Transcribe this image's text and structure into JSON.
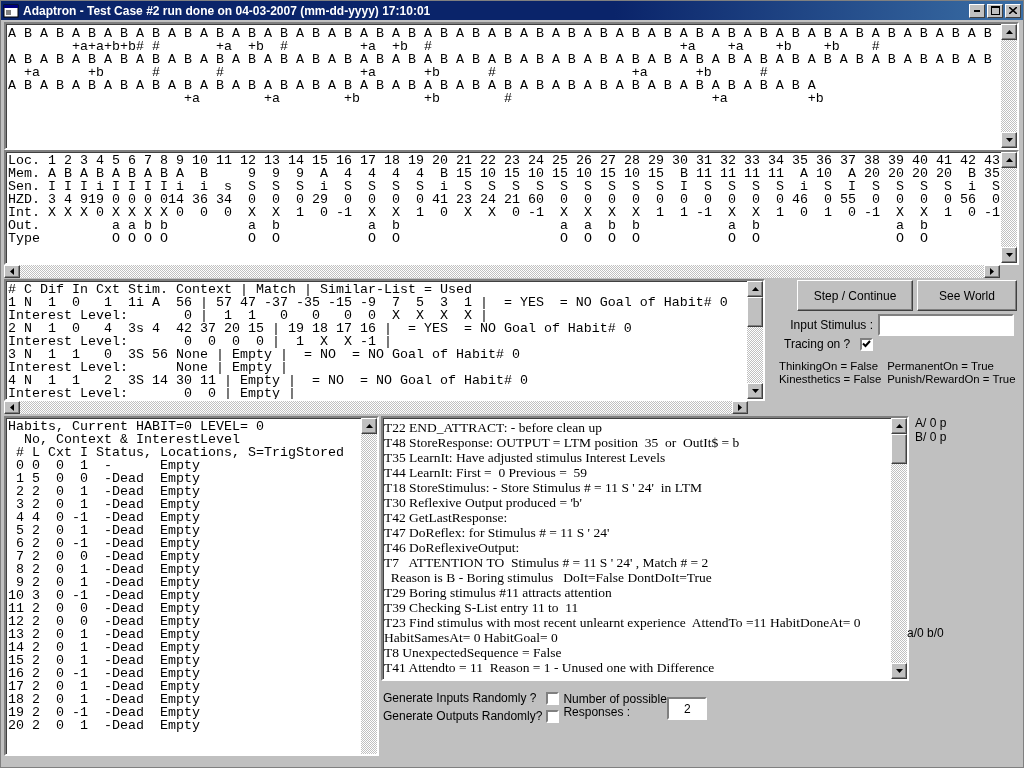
{
  "window": {
    "title": "Adaptron - Test Case #2 run done on 04-03-2007 (mm-dd-yyyy) 17:10:01"
  },
  "sequence_view": {
    "lines": [
      "A B A B A B A B A B A B A B A B A B A B A B A B A B A B A B A B A B A B A B A B A B A B A B A B A B A B A B A B A B A B A B",
      "        +a+a+b+b# #       +a  +b  #         +a  +b  #                               +a    +a    +b    +b    #",
      "A B A B A B A B A B A B A B A B A B A B A B A B A B A B A B A B A B A B A B A B A B A B A B A B A B A B A B A B A B A B A B",
      "  +a      +b      #       #                 +a      +b      #                 +a      +b      #",
      "A B A B A B A B A B A B A B A B A B A B A B A B A B A B A B A B A B A B A B A B A B A B A B A B A B A",
      "                      +a        +a        +b        +b        #                         +a          +b"
    ]
  },
  "memory_table": {
    "columns": [
      "Loc.",
      "1",
      "2",
      "3",
      "4",
      "5",
      "6",
      "7",
      "8",
      "9",
      "10",
      "11",
      "12",
      "13",
      "14",
      "15",
      "16",
      "17",
      "18",
      "19",
      "20",
      "21",
      "22",
      "23",
      "24",
      "25",
      "26",
      "27",
      "28",
      "29",
      "30",
      "31",
      "32",
      "33",
      "34",
      "35",
      "36",
      "37",
      "38",
      "39",
      "40",
      "41",
      "42",
      "43"
    ],
    "rows": [
      {
        "cells": [
          "Mem.",
          "A",
          "B",
          "A",
          "B",
          "A",
          "B",
          "A",
          "B",
          "A",
          "B",
          null,
          "9",
          "9",
          "9",
          "A",
          "4",
          "4",
          "4",
          "4",
          "B",
          "15",
          "10",
          "15",
          "10",
          "15",
          "10",
          "15",
          "10",
          "15",
          "B",
          "11",
          "11",
          "11",
          "11",
          "A",
          "10",
          "A",
          "20",
          "20",
          "20",
          "20",
          "B",
          "35"
        ]
      },
      {
        "cells": [
          "Sen.",
          "I",
          "I",
          "I",
          "i",
          "I",
          "I",
          "I",
          "I",
          "i",
          "i",
          "s",
          "S",
          "S",
          "S",
          "i",
          "S",
          "S",
          "S",
          "S",
          "i",
          "S",
          "S",
          "S",
          "S",
          "S",
          "S",
          "S",
          "S",
          "S",
          "I",
          "S",
          "S",
          "S",
          "S",
          "i",
          "S",
          "I",
          "S",
          "S",
          "S",
          "S",
          "i",
          "S"
        ]
      },
      {
        "cells": [
          "HZD.",
          "3",
          "4",
          "9",
          "19",
          "0",
          "0",
          "0",
          "0",
          "14",
          "36",
          "34",
          "0",
          "0",
          "0",
          "29",
          "0",
          "0",
          "0",
          "0",
          "41",
          "23",
          "24",
          "21",
          "60",
          "0",
          "0",
          "0",
          "0",
          "0",
          "0",
          "0",
          "0",
          "0",
          "0",
          "46",
          "0",
          "55",
          "0",
          "0",
          "0",
          "0",
          "56",
          "0"
        ]
      },
      {
        "cells": [
          "Int.",
          "X",
          "X",
          "X",
          "0",
          "X",
          "X",
          "X",
          "X",
          "0",
          "0",
          "0",
          "X",
          "X",
          "1",
          "0",
          "-1",
          "X",
          "X",
          "1",
          "0",
          "X",
          "X",
          "0",
          "-1",
          "X",
          "X",
          "X",
          "X",
          "1",
          "1",
          "-1",
          "X",
          "X",
          "1",
          "0",
          "1",
          "0",
          "-1",
          "X",
          "X",
          "1",
          "0",
          "-1"
        ]
      },
      {
        "cells": [
          "Out.",
          null,
          null,
          null,
          null,
          "a",
          "a",
          "b",
          "b",
          null,
          null,
          null,
          "a",
          "b",
          null,
          null,
          null,
          "a",
          "b",
          null,
          null,
          null,
          null,
          null,
          null,
          "a",
          "a",
          "b",
          "b",
          null,
          null,
          null,
          "a",
          "b",
          null,
          null,
          null,
          null,
          null,
          "a",
          "b",
          null,
          null,
          null
        ]
      },
      {
        "cells": [
          "Type",
          null,
          null,
          null,
          null,
          "O",
          "O",
          "O",
          "O",
          null,
          null,
          null,
          "O",
          "O",
          null,
          null,
          null,
          "O",
          "O",
          null,
          null,
          null,
          null,
          null,
          null,
          "O",
          "O",
          "O",
          "O",
          null,
          null,
          null,
          "O",
          "O",
          null,
          null,
          null,
          null,
          null,
          "O",
          "O",
          null,
          null,
          null
        ]
      }
    ]
  },
  "context_list": {
    "lines": [
      "# C Dif In Cxt Stim. Context | Match | Similar-List = Used",
      "1 N  1  0   1  1i A  56 | 57 47 -37 -35 -15 -9  7  5  3  1 |  = YES  = NO Goal of Habit# 0",
      "Interest Level:       0 |  1  1   0   0   0  0  X  X  X  X |",
      "2 N  1  0   4  3s 4  42 37 20 15 | 19 18 17 16 |  = YES  = NO Goal of Habit# 0",
      "Interest Level:       0  0  0  0 |  1  X  X -1 |",
      "3 N  1  1   0  3S 56 None | Empty |  = NO  = NO Goal of Habit# 0",
      "Interest Level:      None | Empty |",
      "4 N  1  1   2  3S 14 30 11 | Empty |  = NO  = NO Goal of Habit# 0",
      "Interest Level:       0  0 | Empty |"
    ]
  },
  "controls": {
    "step_button": "Step / Continue",
    "world_button": "See World",
    "input_stimulus": {
      "label": "Input Stimulus :"
    },
    "tracing": {
      "label": "Tracing on ?",
      "checked": true
    },
    "status_lines": [
      [
        "ThinkingOn = False",
        "PermanentOn = True"
      ],
      [
        "Kinesthetics = False",
        "Punish/RewardOn = True"
      ]
    ]
  },
  "habits": {
    "lines": [
      "Habits, Current HABIT=0 LEVEL= 0",
      "  No, Context & InterestLevel",
      " # L Cxt I Status, Locations, S=TrigStored",
      " 0 0  0  1  -      Empty",
      " 1 5  0  0  -Dead  Empty",
      " 2 2  0  1  -Dead  Empty",
      " 3 2  0  1  -Dead  Empty",
      " 4 4  0 -1  -Dead  Empty",
      " 5 2  0  1  -Dead  Empty",
      " 6 2  0 -1  -Dead  Empty",
      " 7 2  0  0  -Dead  Empty",
      " 8 2  0  1  -Dead  Empty",
      " 9 2  0  1  -Dead  Empty",
      "10 3  0 -1  -Dead  Empty",
      "11 2  0  0  -Dead  Empty",
      "12 2  0  0  -Dead  Empty",
      "13 2  0  1  -Dead  Empty",
      "14 2  0  1  -Dead  Empty",
      "15 2  0  1  -Dead  Empty",
      "16 2  0 -1  -Dead  Empty",
      "17 2  0  1  -Dead  Empty",
      "18 2  0  1  -Dead  Empty",
      "19 2  0 -1  -Dead  Empty",
      "20 2  0  1  -Dead  Empty"
    ]
  },
  "trace_log": {
    "lines": [
      "T22 END_ATTRACT: - before clean up",
      "T48 StoreResponse: OUTPUT = LTM position  35  or  OutIt$ = b",
      "T35 LearnIt: Have adjusted stimulus Interest Levels",
      "T44 LearnIt: First =  0 Previous =  59",
      "T18 StoreStimulus: - Store Stimulus # = 11 S ' 24'  in LTM",
      "T30 Reflexive Output produced = 'b'",
      "T42 GetLastResponse:",
      "T47 DoReflex: for Stimulus # = 11 S ' 24'",
      "T46 DoReflexiveOutput:",
      "T7   ATTENTION TO  Stimulus # = 11 S ' 24' , Match # = 2",
      "  Reason is B - Boring stimulus   DoIt=False DontDoIt=True",
      "T29 Boring stimulus #11 attracts attention",
      "T39 Checking S-List entry 11 to  11",
      "T23 Find stimulus with most recent unlearnt experience  AttendTo =11 HabitDoneAt= 0",
      "HabitSamesAt= 0 HabitGoal= 0",
      "T8 UnexpectedSequence = False",
      "T41 Attendto = 11  Reason = 1 - Unused one with Difference"
    ]
  },
  "counters": {
    "top": [
      "A/ 0 p",
      "B/ 0 p"
    ],
    "bottom": "a/0  b/0"
  },
  "generate": [
    {
      "label": "Generate Inputs Randomly ?",
      "checked": false
    },
    {
      "label": "Generate Outputs Randomly?",
      "checked": false
    }
  ],
  "responses": {
    "label": "Number of possible Responses :",
    "value": "2"
  }
}
